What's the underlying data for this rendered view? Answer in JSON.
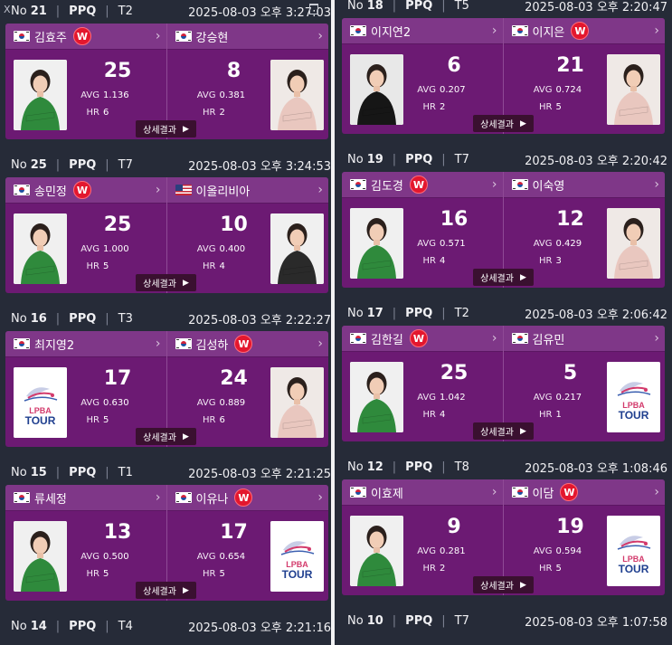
{
  "detail_label": "상세결과",
  "w_label": "W",
  "left_column": [
    {
      "no_label": "No",
      "no": "21",
      "type": "PPQ",
      "table": "T2",
      "time": "2025-08-03 오후 3:27:03",
      "p1": {
        "name": "김효주",
        "flag": "kr",
        "w": true,
        "score": "25",
        "avg": "1.136",
        "hr": "6",
        "photo": "photo"
      },
      "p2": {
        "name": "강승현",
        "flag": "kr",
        "w": false,
        "score": "8",
        "avg": "0.381",
        "hr": "2",
        "photo": "photo"
      }
    },
    {
      "no_label": "No",
      "no": "25",
      "type": "PPQ",
      "table": "T7",
      "time": "2025-08-03 오후 3:24:53",
      "p1": {
        "name": "송민정",
        "flag": "kr",
        "w": true,
        "score": "25",
        "avg": "1.000",
        "hr": "5",
        "photo": "photo"
      },
      "p2": {
        "name": "이올리비아",
        "flag": "us",
        "w": false,
        "score": "10",
        "avg": "0.400",
        "hr": "4",
        "photo": "photo"
      }
    },
    {
      "no_label": "No",
      "no": "16",
      "type": "PPQ",
      "table": "T3",
      "time": "2025-08-03 오후 2:22:27",
      "p1": {
        "name": "최지영2",
        "flag": "kr",
        "w": false,
        "score": "17",
        "avg": "0.630",
        "hr": "5",
        "photo": "logo"
      },
      "p2": {
        "name": "김성하",
        "flag": "kr",
        "w": true,
        "score": "24",
        "avg": "0.889",
        "hr": "6",
        "photo": "photo"
      }
    },
    {
      "no_label": "No",
      "no": "15",
      "type": "PPQ",
      "table": "T1",
      "time": "2025-08-03 오후 2:21:25",
      "p1": {
        "name": "류세정",
        "flag": "kr",
        "w": false,
        "score": "13",
        "avg": "0.500",
        "hr": "5",
        "photo": "photo"
      },
      "p2": {
        "name": "이유나",
        "flag": "kr",
        "w": true,
        "score": "17",
        "avg": "0.654",
        "hr": "5",
        "photo": "logo"
      }
    },
    {
      "no_label": "No",
      "no": "14",
      "type": "PPQ",
      "table": "T4",
      "time": "2025-08-03 오후 2:21:16"
    }
  ],
  "right_column": [
    {
      "no_label": "No",
      "no": "18",
      "type": "PPQ",
      "table": "T5",
      "time": "2025-08-03 오후 2:20:47",
      "p1": {
        "name": "이지연2",
        "flag": "kr",
        "w": false,
        "score": "6",
        "avg": "0.207",
        "hr": "2",
        "photo": "photo"
      },
      "p2": {
        "name": "이지은",
        "flag": "kr",
        "w": true,
        "score": "21",
        "avg": "0.724",
        "hr": "5",
        "photo": "photo"
      }
    },
    {
      "no_label": "No",
      "no": "19",
      "type": "PPQ",
      "table": "T7",
      "time": "2025-08-03 오후 2:20:42",
      "p1": {
        "name": "김도경",
        "flag": "kr",
        "w": true,
        "score": "16",
        "avg": "0.571",
        "hr": "4",
        "photo": "photo"
      },
      "p2": {
        "name": "이숙영",
        "flag": "kr",
        "w": false,
        "score": "12",
        "avg": "0.429",
        "hr": "3",
        "photo": "photo"
      }
    },
    {
      "no_label": "No",
      "no": "17",
      "type": "PPQ",
      "table": "T2",
      "time": "2025-08-03 오후 2:06:42",
      "p1": {
        "name": "김한길",
        "flag": "kr",
        "w": true,
        "score": "25",
        "avg": "1.042",
        "hr": "4",
        "photo": "photo"
      },
      "p2": {
        "name": "김유민",
        "flag": "kr",
        "w": false,
        "score": "5",
        "avg": "0.217",
        "hr": "1",
        "photo": "logo"
      }
    },
    {
      "no_label": "No",
      "no": "12",
      "type": "PPQ",
      "table": "T8",
      "time": "2025-08-03 오후 1:08:46",
      "p1": {
        "name": "이효제",
        "flag": "kr",
        "w": false,
        "score": "9",
        "avg": "0.281",
        "hr": "2",
        "photo": "photo"
      },
      "p2": {
        "name": "이담",
        "flag": "kr",
        "w": true,
        "score": "19",
        "avg": "0.594",
        "hr": "5",
        "photo": "logo"
      }
    },
    {
      "no_label": "No",
      "no": "10",
      "type": "PPQ",
      "table": "T7",
      "time": "2025-08-03 오후 1:07:58"
    }
  ],
  "stat_labels": {
    "avg": "AVG",
    "hr": "HR"
  },
  "logo_text": {
    "line1": "LPBA",
    "line2": "TOUR"
  },
  "overlay": {
    "close_label": "X"
  },
  "colors": {
    "card_bg": "#6c1a73",
    "name_bar": "#7f3788",
    "win_badge": "#e3172e",
    "page_bg": "#262b38"
  }
}
